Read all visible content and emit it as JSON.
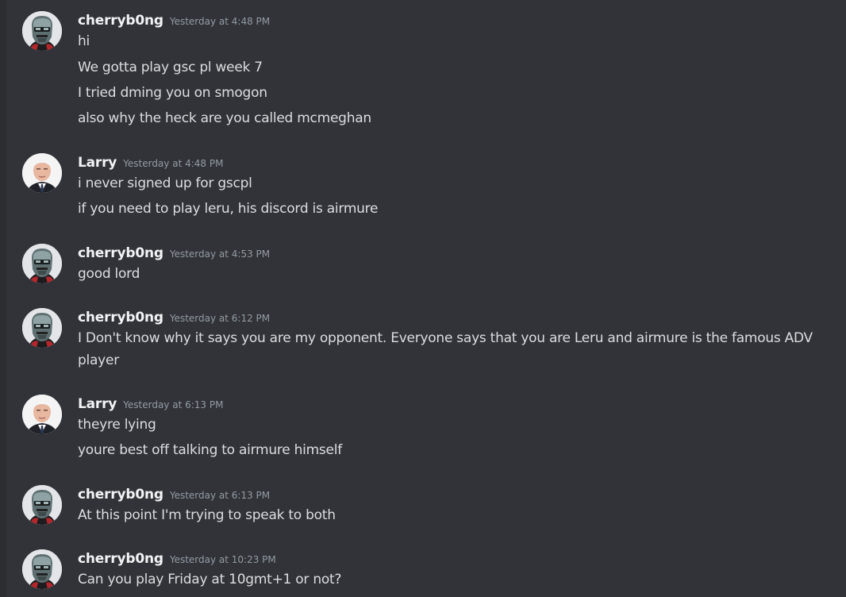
{
  "messages": [
    {
      "author": "cherryb0ng",
      "avatar_icon": "masked-villain-avatar-icon",
      "timestamp": "Yesterday at 4:48 PM",
      "lines": [
        "hi",
        "We gotta play gsc pl week 7",
        "I tried dming you on smogon",
        "also why the heck are you called mcmeghan"
      ]
    },
    {
      "author": "Larry",
      "avatar_icon": "white-haired-man-avatar-icon",
      "timestamp": "Yesterday at 4:48 PM",
      "lines": [
        "i never signed up for gscpl",
        "if you need to play leru, his discord is airmure"
      ]
    },
    {
      "author": "cherryb0ng",
      "avatar_icon": "masked-villain-avatar-icon",
      "timestamp": "Yesterday at 4:53 PM",
      "lines": [
        "good lord"
      ]
    },
    {
      "author": "cherryb0ng",
      "avatar_icon": "masked-villain-avatar-icon",
      "timestamp": "Yesterday at 6:12 PM",
      "lines": [
        "I Don't know why it says you are my opponent. Everyone says that you are Leru and airmure is the famous ADV player"
      ]
    },
    {
      "author": "Larry",
      "avatar_icon": "white-haired-man-avatar-icon",
      "timestamp": "Yesterday at 6:13 PM",
      "lines": [
        "theyre lying",
        "youre best off talking to airmure himself"
      ]
    },
    {
      "author": "cherryb0ng",
      "avatar_icon": "masked-villain-avatar-icon",
      "timestamp": "Yesterday at 6:13 PM",
      "lines": [
        "At this point I'm trying to speak to both"
      ]
    },
    {
      "author": "cherryb0ng",
      "avatar_icon": "masked-villain-avatar-icon",
      "timestamp": "Yesterday at 10:23 PM",
      "lines": [
        "Can you play Friday at 10gmt+1 or not?"
      ]
    }
  ],
  "colors": {
    "background": "#313338",
    "username": "#f2f3f5",
    "timestamp": "#949ba4",
    "message_text": "#dbdee1"
  }
}
